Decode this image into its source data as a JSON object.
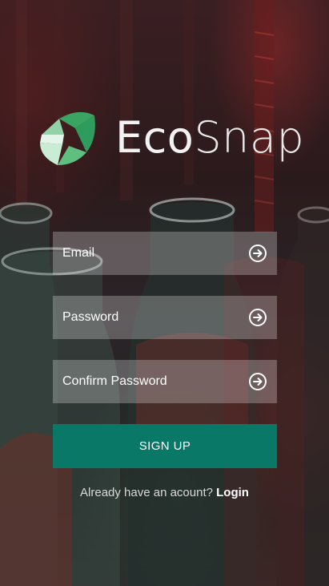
{
  "app": {
    "name_part1": "Eco",
    "name_part2": "Snap"
  },
  "form": {
    "email_placeholder": "Email",
    "password_placeholder": "Password",
    "confirm_placeholder": "Confirm Password",
    "field_action_icon": "arrow-circle-right-icon",
    "signup_label": "SIGN UP"
  },
  "footer": {
    "prompt": "Already have an acount?",
    "login_label": "Login"
  },
  "colors": {
    "accent": "#097866",
    "logo_green_dark": "#2e9c5c",
    "logo_green_mid": "#5fbf7e",
    "logo_green_light": "#c8ecd4"
  }
}
